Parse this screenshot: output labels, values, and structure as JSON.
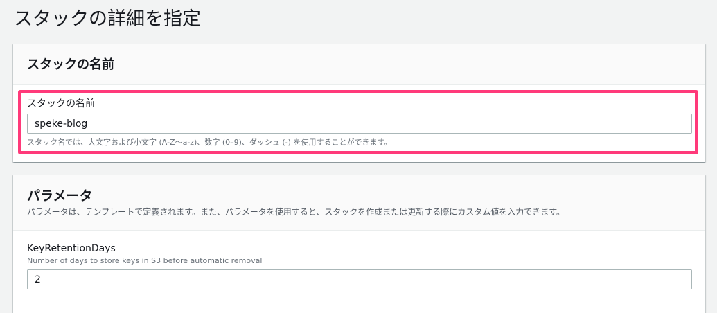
{
  "page": {
    "title": "スタックの詳細を指定"
  },
  "stack_name_section": {
    "title": "スタックの名前",
    "field_label": "スタックの名前",
    "field_value": "speke-blog",
    "field_hint": "スタック名では、大文字および小文字 (A-Z〜a-z)、数字 (0–9)、ダッシュ (-) を使用することができます。",
    "highlight_color": "#ff3a7a"
  },
  "parameters_section": {
    "title": "パラメータ",
    "description": "パラメータは、テンプレートで定義されます。また、パラメータを使用すると、スタックを作成または更新する際にカスタム値を入力できます。",
    "params": [
      {
        "label": "KeyRetentionDays",
        "description": "Number of days to store keys in S3 before automatic removal",
        "value": "2"
      }
    ]
  }
}
